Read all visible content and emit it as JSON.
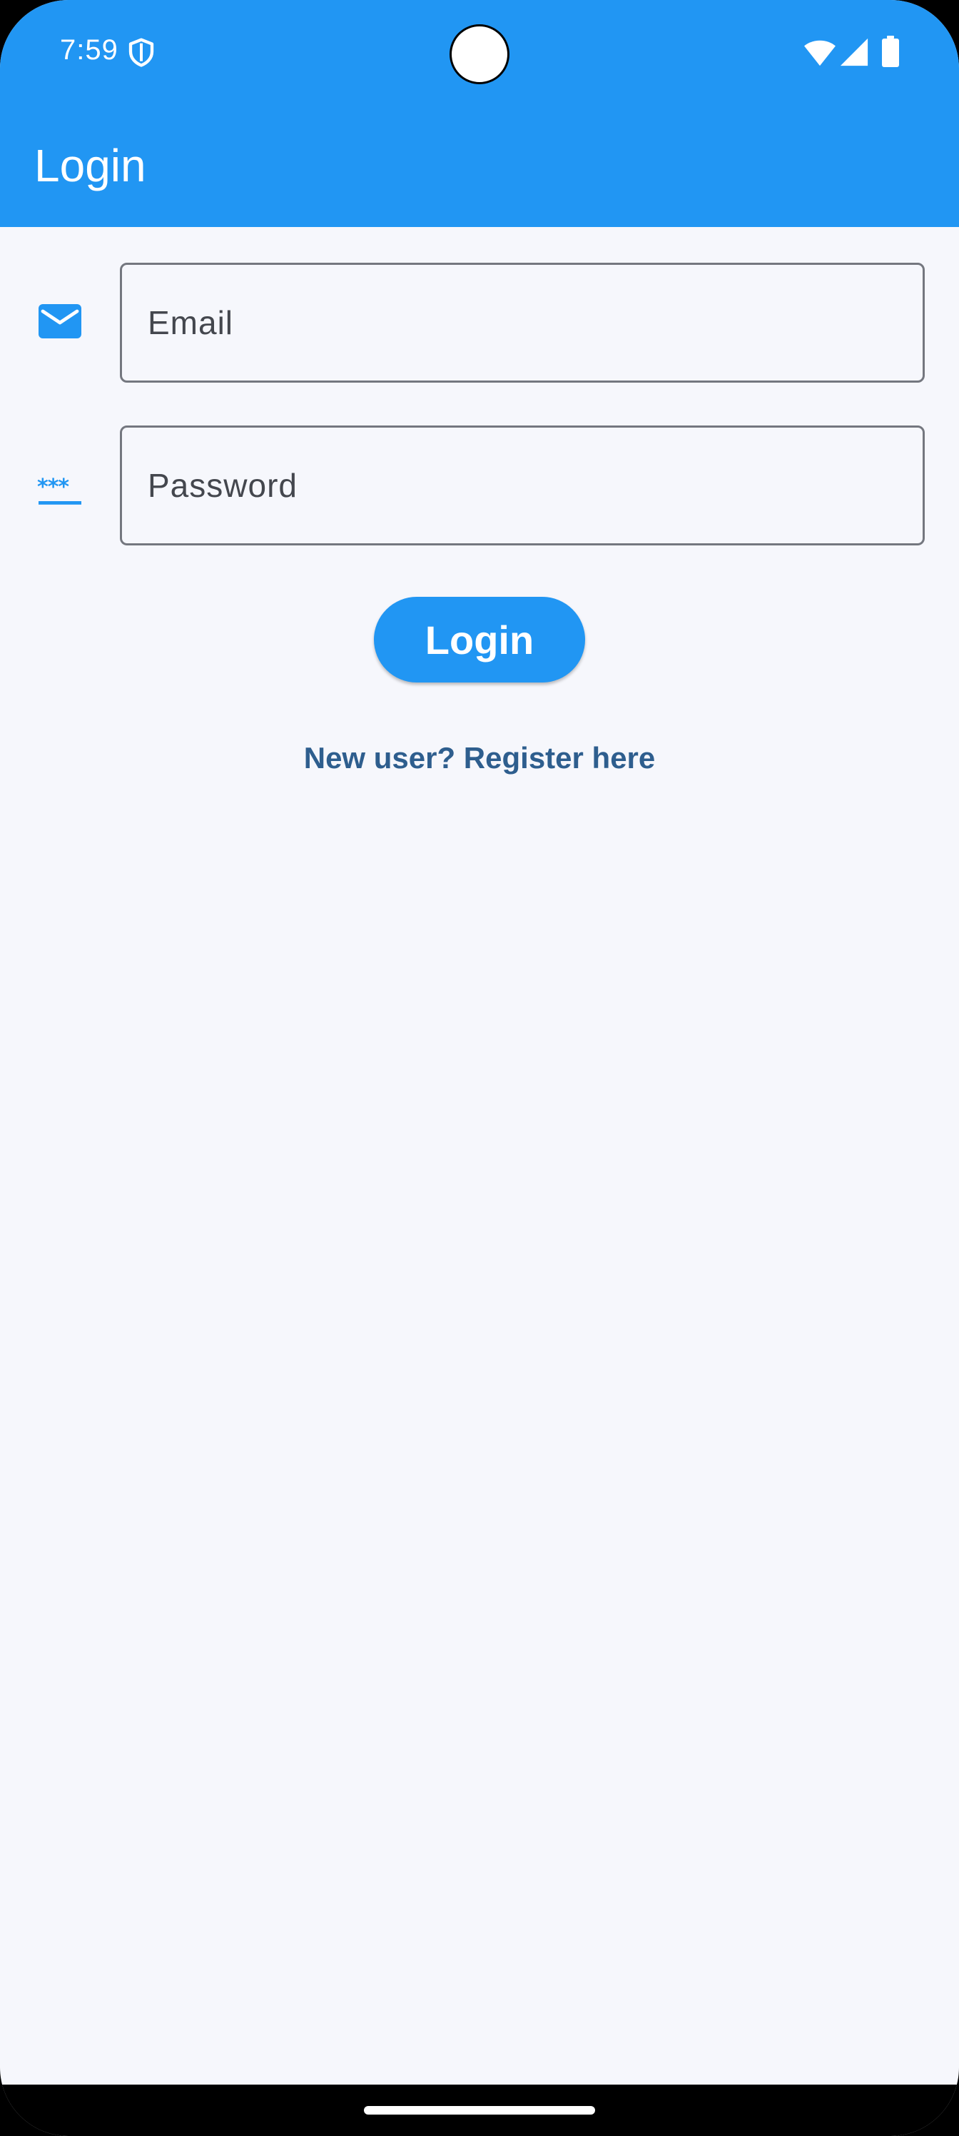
{
  "status_bar": {
    "time": "7:59",
    "icons": [
      "shield-icon",
      "wifi-icon",
      "signal-icon",
      "battery-icon"
    ]
  },
  "app_bar": {
    "title": "Login"
  },
  "form": {
    "email": {
      "placeholder": "Email",
      "value": "",
      "icon": "mail-icon"
    },
    "password": {
      "placeholder": "Password",
      "value": "",
      "icon": "password-icon"
    },
    "login_label": "Login",
    "register_link": "New user? Register here"
  },
  "colors": {
    "primary": "#2196F3",
    "background": "#F6F7FC",
    "link": "#2E5E8E",
    "outline": "#74777F"
  }
}
